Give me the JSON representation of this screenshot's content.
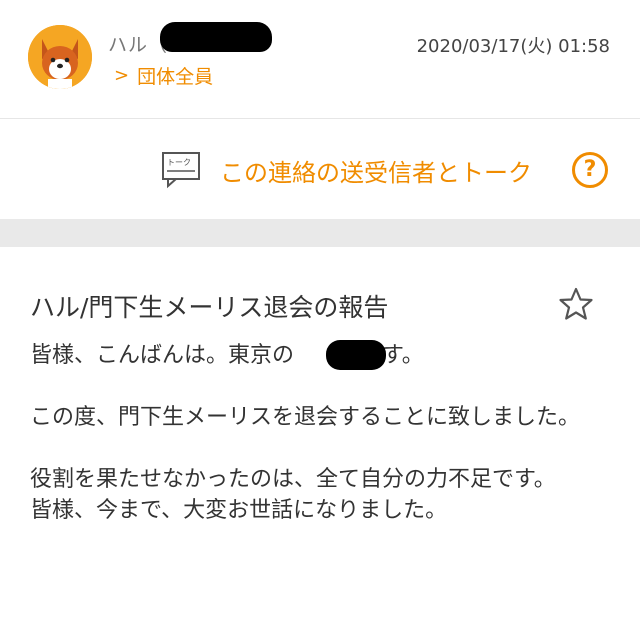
{
  "header": {
    "sender_name": "ハル（",
    "sender_suffix": "）",
    "timestamp": "2020/03/17(火) 01:58",
    "group_chevron": ">",
    "group_label": "団体全員"
  },
  "talk": {
    "icon_text": "トーク",
    "label": "この連絡の送受信者とトーク",
    "help_glyph": "?"
  },
  "message": {
    "subject": "ハル/門下生メーリス退会の報告",
    "body": "皆様、こんばんは。東京の　　　です。\n\nこの度、門下生メーリスを退会することに致しました。\n\n役割を果たせなかったのは、全て自分の力不足です。\n皆様、今まで、大変お世話になりました。"
  },
  "colors": {
    "accent": "#f08c00",
    "band": "#e9e9e9"
  }
}
